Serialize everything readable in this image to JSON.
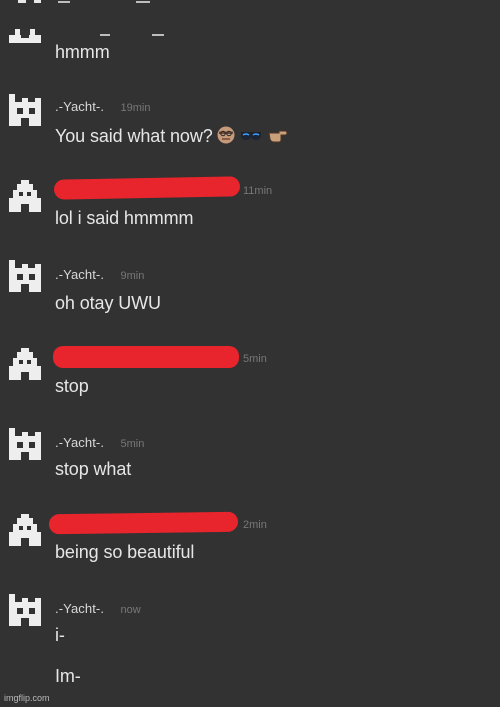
{
  "colors": {
    "background": "#323232",
    "message_text": "#e6e6e6",
    "username": "#d8d8d8",
    "timestamp": "#777777",
    "redaction": "#e8242c",
    "avatar": "#eeeeee"
  },
  "messages": [
    {
      "author": "",
      "author_redacted": true,
      "time": "",
      "avatar_icon": "pixel-avatar-icon",
      "lines": [
        "hmmm"
      ]
    },
    {
      "author": ".-Yacht-.",
      "author_redacted": false,
      "time": "19min",
      "avatar_icon": "pixel-avatar-icon",
      "lines": [
        "You said what now?"
      ],
      "emojis": [
        "man-face-emoji",
        "sunglasses-emoji",
        "pointing-hand-emoji"
      ]
    },
    {
      "author": "",
      "author_redacted": true,
      "time": "11min",
      "avatar_icon": "pixel-avatar-icon",
      "lines": [
        "lol i said hmmmm"
      ]
    },
    {
      "author": ".-Yacht-.",
      "author_redacted": false,
      "time": "9min",
      "avatar_icon": "pixel-avatar-icon",
      "lines": [
        "oh otay UWU"
      ]
    },
    {
      "author": "",
      "author_redacted": true,
      "time": "5min",
      "avatar_icon": "pixel-avatar-icon",
      "lines": [
        "stop"
      ]
    },
    {
      "author": ".-Yacht-.",
      "author_redacted": false,
      "time": "5min",
      "avatar_icon": "pixel-avatar-icon",
      "lines": [
        "stop what"
      ]
    },
    {
      "author": "",
      "author_redacted": true,
      "time": "2min",
      "avatar_icon": "pixel-avatar-icon",
      "lines": [
        "being so beautiful"
      ]
    },
    {
      "author": ".-Yacht-.",
      "author_redacted": false,
      "time": "now",
      "avatar_icon": "pixel-avatar-icon",
      "lines": [
        "i-",
        "Im-"
      ]
    }
  ],
  "watermark": "imgflip.com"
}
